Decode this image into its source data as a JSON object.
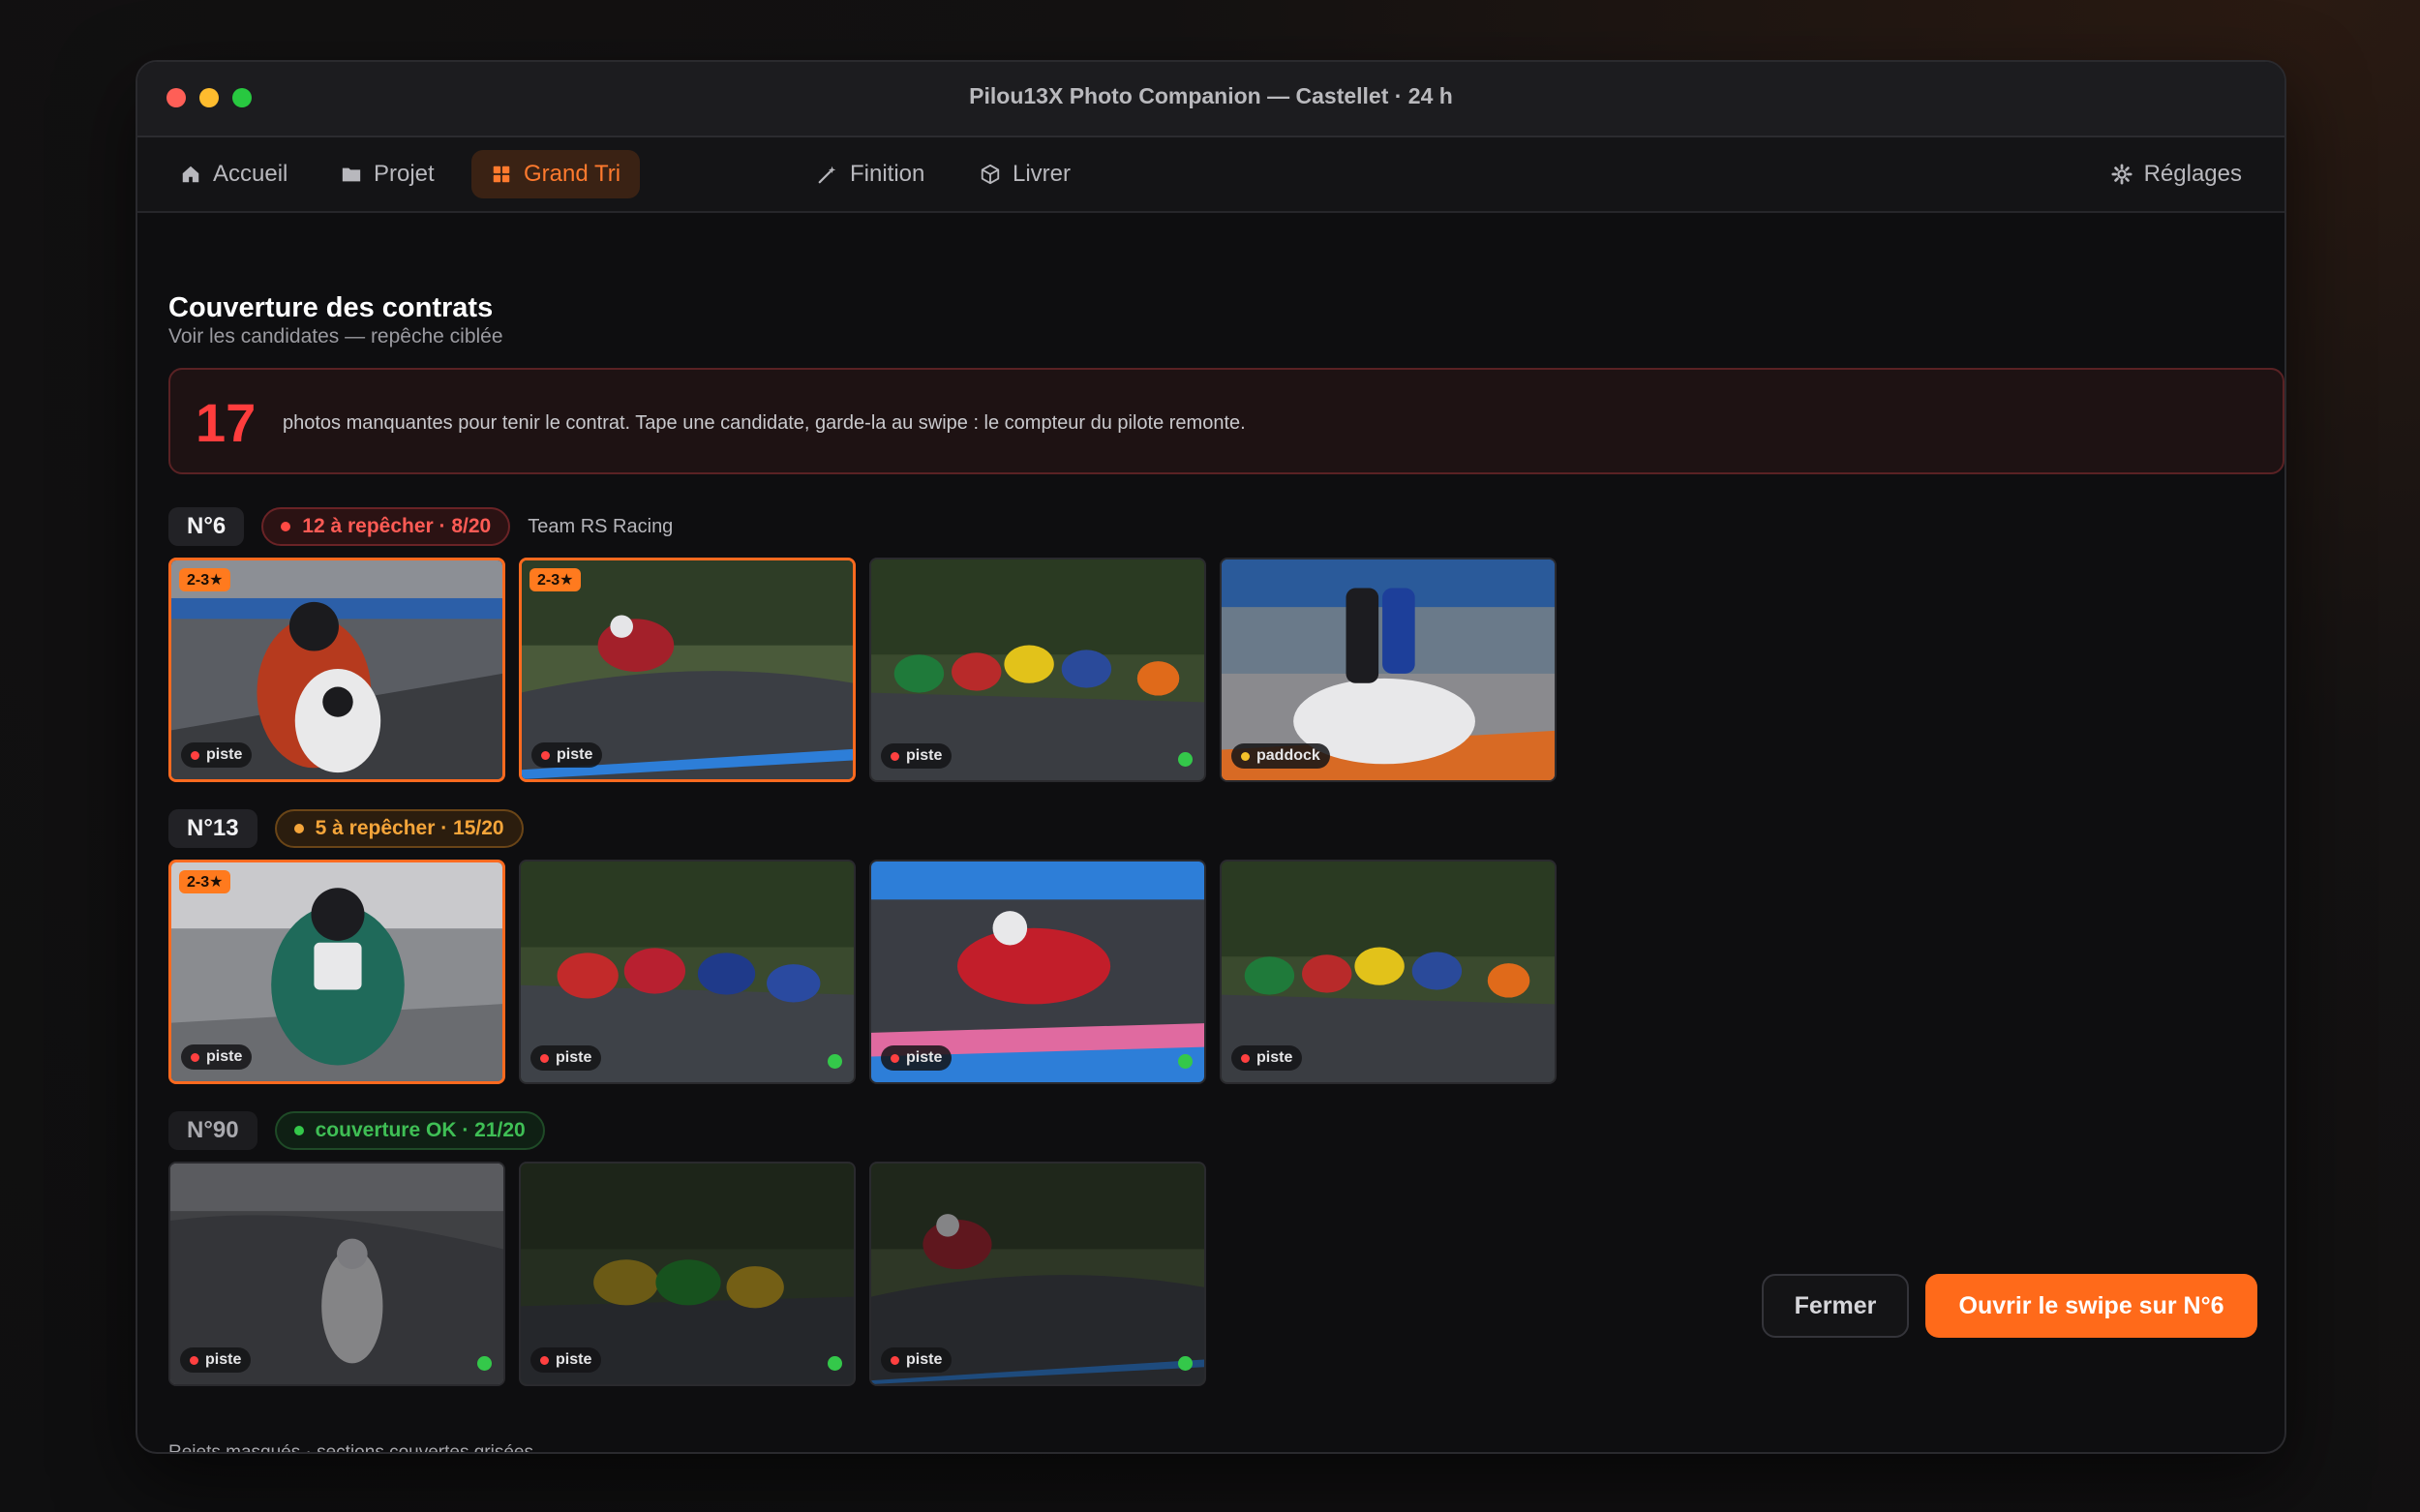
{
  "window": {
    "title": "Pilou13X Photo Companion — Castellet · 24 h"
  },
  "nav": {
    "tabs": [
      {
        "label": "Accueil",
        "icon": "home-icon"
      },
      {
        "label": "Projet",
        "icon": "folder-icon"
      },
      {
        "label": "Grand Tri",
        "icon": "grid-icon",
        "active": true
      },
      {
        "label": "Finition",
        "icon": "wand-icon"
      },
      {
        "label": "Livrer",
        "icon": "box-icon"
      }
    ],
    "settings": {
      "label": "Réglages",
      "icon": "gear-icon"
    }
  },
  "page": {
    "title": "Couverture des contrats",
    "subtitle": "Voir les candidates — repêche ciblée"
  },
  "alert": {
    "count": "17",
    "text": "photos manquantes pour tenir le contrat. Tape une candidate, garde-la au swipe : le compteur du pilote remonte."
  },
  "sections": [
    {
      "number": "N°6",
      "status": "12 à repêcher · 8/20",
      "team": "Team RS Racing",
      "photos": [
        {
          "tag": "piste",
          "stars": "2-3★"
        },
        {
          "tag": "piste",
          "stars": "2-3★"
        },
        {
          "tag": "piste"
        },
        {
          "tag": "paddock"
        }
      ]
    },
    {
      "number": "N°13",
      "status": "5 à repêcher · 15/20",
      "photos": [
        {
          "tag": "piste",
          "stars": "2-3★"
        },
        {
          "tag": "piste"
        },
        {
          "tag": "piste"
        },
        {
          "tag": "piste"
        }
      ]
    },
    {
      "number": "N°90",
      "status": "couverture OK · 21/20",
      "photos": [
        {
          "tag": "piste"
        },
        {
          "tag": "piste"
        },
        {
          "tag": "piste"
        }
      ]
    }
  ],
  "footer": {
    "note": "Rejets masqués · sections couvertes grisées",
    "close_label": "Fermer",
    "open_label": "Ouvrir le swipe sur N°6"
  },
  "colors": {
    "accent": "#ff6a1a",
    "danger": "#ff4a44",
    "warning": "#f5a53a",
    "success": "#34c84a"
  }
}
